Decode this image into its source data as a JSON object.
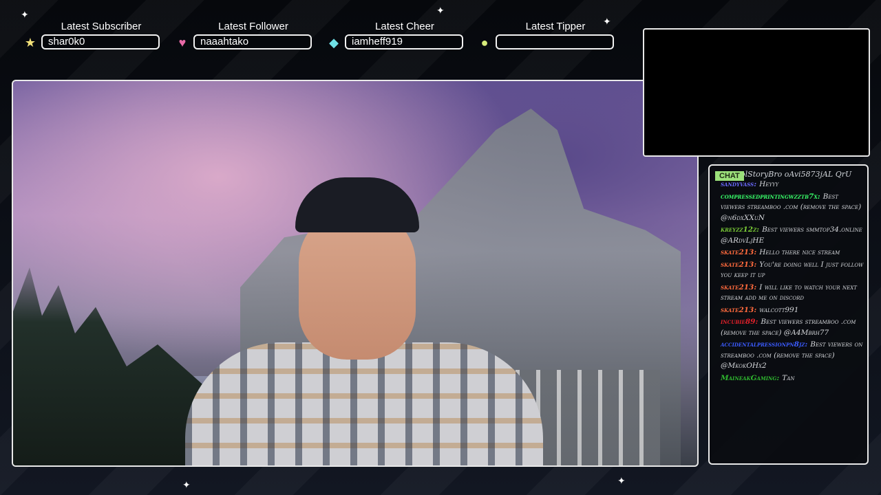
{
  "colors": {
    "subscriber_icon": "#f3e27a",
    "follower_icon": "#e86aa7",
    "cheer_icon": "#6fe0e6",
    "tipper_icon": "#d7ec7a",
    "chat_tab": "#9be07a"
  },
  "widgets": [
    {
      "title": "Latest Subscriber",
      "value": "shar0k0",
      "icon": "star-icon"
    },
    {
      "title": "Latest Follower",
      "value": "naaahtako",
      "icon": "heart-icon"
    },
    {
      "title": "Latest Cheer",
      "value": "iamheff919",
      "icon": "diamond-icon"
    },
    {
      "title": "Latest Tipper",
      "value": "",
      "icon": "coin-icon"
    }
  ],
  "chat": {
    "tab_label": "CHAT",
    "cut_line": "CoolStoryBro oAvi5873jAL QrU",
    "messages": [
      {
        "user": "sandyvass:",
        "color": "#6b6bff",
        "text": "Heyyy"
      },
      {
        "user": "compressedprintingwzztb7x:",
        "color": "#39ff6a",
        "text": "Best viewers streamboo .com (remove the space) @n6dxXXuN"
      },
      {
        "user": "kreyzz12z:",
        "color": "#7acb36",
        "text": "Best viewers smmtop34.online @ARdvLjHE"
      },
      {
        "user": "skate213:",
        "color": "#ff6a3d",
        "text": "Hello there nice stream"
      },
      {
        "user": "skate213:",
        "color": "#ff6a3d",
        "text": "You're doing well I just follow you keep it up"
      },
      {
        "user": "skate213:",
        "color": "#ff6a3d",
        "text": "I will like to watch your next stream add me on discord"
      },
      {
        "user": "skate213:",
        "color": "#ff6a3d",
        "text": "walcott991"
      },
      {
        "user": "incubie89:",
        "color": "#e0202a",
        "text": "Best viewers streamboo .com (remove the space) @A4Mbrh77"
      },
      {
        "user": "accidentalpressionpn8jz:",
        "color": "#3b5bff",
        "text": "Best viewers on streamboo .com (remove the space) @MkokOHx2"
      },
      {
        "user": "MaineakGaming:",
        "color": "#2fb82f",
        "text": "Tan"
      }
    ]
  }
}
